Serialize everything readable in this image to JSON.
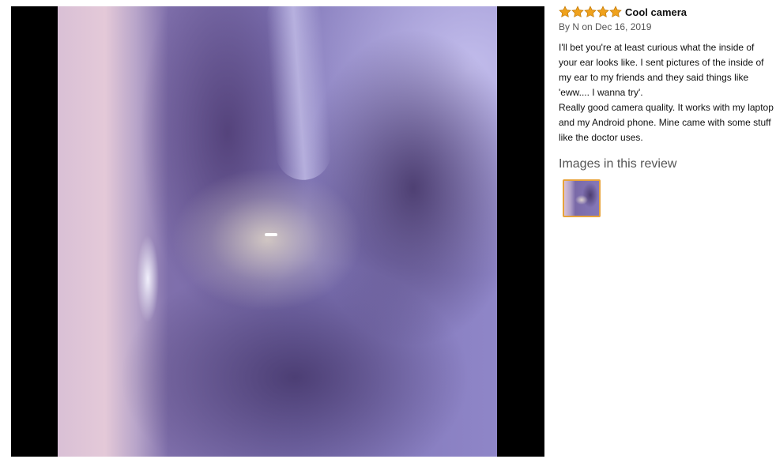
{
  "review": {
    "rating": 5,
    "rating_max": 5,
    "star_color": "#f0a21c",
    "title": "Cool camera",
    "byline": "By N on Dec 16, 2019",
    "body": [
      "I'll bet you're at least curious what the inside of your ear looks like. I sent pictures of the inside of my ear to my friends and they said things like 'eww.... I wanna try'.",
      "Really good camera quality. It works with my laptop and my Android phone. Mine came with some stuff like the doctor uses."
    ],
    "images_heading": "Images in this review",
    "thumbnail_selected_color": "#e8a33a"
  }
}
